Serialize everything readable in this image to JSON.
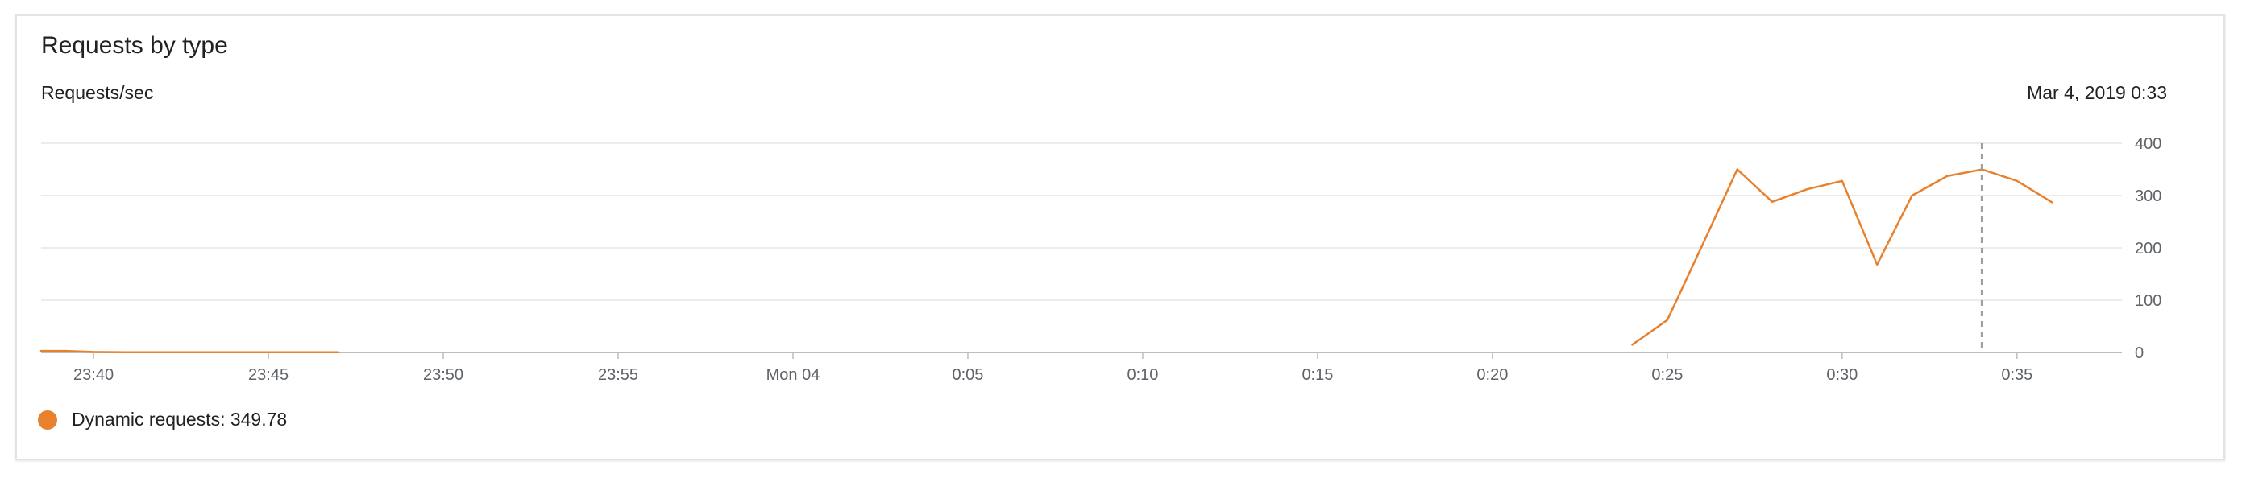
{
  "card": {
    "title": "Requests by type",
    "subtitle": "Requests/sec",
    "timestamp": "Mar 4, 2019 0:33"
  },
  "legend": {
    "label": "Dynamic requests: 349.78",
    "color": "#e8812d"
  },
  "chart_data": {
    "type": "line",
    "ylabel": "Requests/sec",
    "ylim": [
      0,
      400
    ],
    "y_ticks": [
      0,
      100,
      200,
      300,
      400
    ],
    "x_unit": "minutes since 23:40",
    "xlim": [
      -1.5,
      58
    ],
    "x_ticks": [
      {
        "value": 0,
        "label": "23:40"
      },
      {
        "value": 5,
        "label": "23:45"
      },
      {
        "value": 10,
        "label": "23:50"
      },
      {
        "value": 15,
        "label": "23:55"
      },
      {
        "value": 20,
        "label": "Mon 04"
      },
      {
        "value": 25,
        "label": "0:05"
      },
      {
        "value": 30,
        "label": "0:10"
      },
      {
        "value": 35,
        "label": "0:15"
      },
      {
        "value": 40,
        "label": "0:20"
      },
      {
        "value": 45,
        "label": "0:25"
      },
      {
        "value": 50,
        "label": "0:30"
      },
      {
        "value": 55,
        "label": "0:35"
      }
    ],
    "cursor_x": 54,
    "grid": true,
    "legend_position": "bottom-left",
    "series": [
      {
        "name": "Dynamic requests",
        "color": "#e8812d",
        "segments": [
          {
            "x": [
              -1.5,
              -0.8,
              0,
              1,
              2,
              3,
              4,
              5,
              6,
              7
            ],
            "y": [
              3,
              3,
              1,
              0.5,
              0.5,
              0.5,
              0.5,
              0.5,
              0.5,
              0.5
            ]
          },
          {
            "x": [
              44,
              45,
              46,
              47,
              48,
              49,
              50,
              51,
              52,
              53,
              54,
              55,
              56
            ],
            "y": [
              15,
              62,
              205,
              350,
              288,
              312,
              328,
              168,
              300,
              337,
              349.78,
              328,
              287
            ]
          }
        ]
      }
    ]
  }
}
